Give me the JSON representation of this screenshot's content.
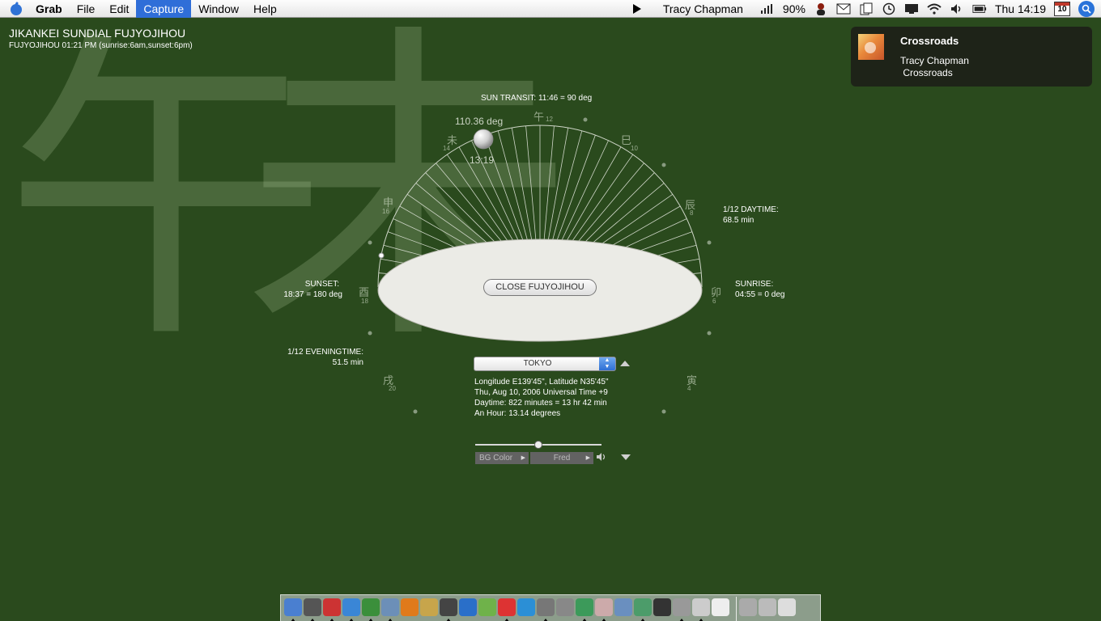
{
  "menubar": {
    "app_name": "Grab",
    "menus": [
      "File",
      "Edit",
      "Capture",
      "Window",
      "Help"
    ],
    "active_menu": "Capture",
    "now_playing": "Tracy Chapman",
    "battery": "90%",
    "clock": "Thu 14:19",
    "calendar_day": "10",
    "icons": [
      "apple-icon",
      "play-icon",
      "signal-icon",
      "user-icon",
      "mail-icon",
      "copy-icon",
      "timemachine-icon",
      "display-icon",
      "wifi-icon",
      "volume-icon",
      "battery-icon",
      "calendar-icon",
      "spotlight-icon"
    ]
  },
  "app": {
    "title": "JIKANKEI SUNDIAL FUJYOJIHOU",
    "subtitle": "FUJYOJIHOU 01:21 PM (sunrise:6am,sunset:6pm)"
  },
  "watermark": {
    "glyph1": "午",
    "glyph2": "未"
  },
  "notification": {
    "title": "Crossroads",
    "line1": "Tracy Chapman",
    "line2": " Crossroads"
  },
  "sundial": {
    "sun_transit": "SUN TRANSIT: 11:46 = 90 deg",
    "sun_deg": "110.36 deg",
    "sun_time": "13:19",
    "daytime_title": "1/12 DAYTIME:",
    "daytime_value": "68.5 min",
    "sunrise_title": "SUNRISE:",
    "sunrise_value": "04:55 = 0 deg",
    "sunset_title": "SUNSET:",
    "sunset_value": "18:37 = 180 deg",
    "evening_title": "1/12 EVENINGTIME:",
    "evening_value": "51.5 min",
    "close_label": "CLOSE FUJYOJIHOU",
    "hours": [
      {
        "glyph": "午",
        "num": "12"
      },
      {
        "glyph": "未",
        "num": "14"
      },
      {
        "glyph": "巳",
        "num": "10"
      },
      {
        "glyph": "申",
        "num": "16"
      },
      {
        "glyph": "辰",
        "num": "8"
      },
      {
        "glyph": "酉",
        "num": "18"
      },
      {
        "glyph": "卯",
        "num": "6"
      },
      {
        "glyph": "戌",
        "num": "20"
      },
      {
        "glyph": "寅",
        "num": "4"
      }
    ]
  },
  "location": {
    "selected": "TOKYO",
    "coords": "Longitude  E139'45\", Latitude N35'45\"",
    "date": "Thu, Aug 10, 2006 Universal Time +9",
    "daytime": "Daytime: 822 minutes = 13 hr 42 min",
    "an_hour": "An Hour: 13.14 degrees"
  },
  "controls": {
    "bg_color_label": "BG Color",
    "voice_label": "Fred"
  }
}
